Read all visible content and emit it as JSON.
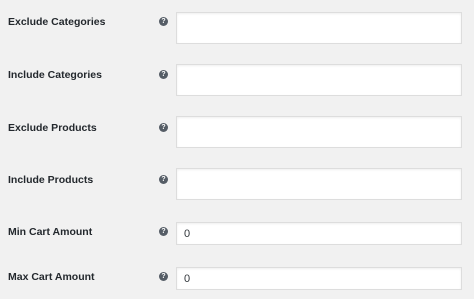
{
  "settings": {
    "rows": [
      {
        "label": "Exclude Categories",
        "help_icon": "question-circle-icon",
        "value": ""
      },
      {
        "label": "Include Categories",
        "help_icon": "question-circle-icon",
        "value": ""
      },
      {
        "label": "Exclude Products",
        "help_icon": "question-circle-icon",
        "value": ""
      },
      {
        "label": "Include Products",
        "help_icon": "question-circle-icon",
        "value": ""
      },
      {
        "label": "Min Cart Amount",
        "help_icon": "question-circle-icon",
        "value": "0"
      },
      {
        "label": "Max Cart Amount",
        "help_icon": "question-circle-icon",
        "value": "0"
      }
    ],
    "help_glyph": "?"
  },
  "colors": {
    "background": "#f1f1f1",
    "label_text": "#23282d",
    "help_icon": "#555d66",
    "field_border": "#dddddd"
  }
}
